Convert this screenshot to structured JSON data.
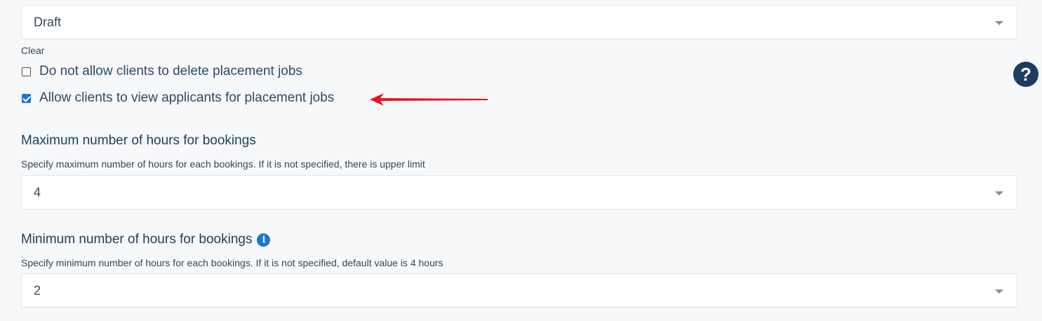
{
  "status_select": {
    "value": "Draft"
  },
  "clear_label": "Clear",
  "checkboxes": [
    {
      "label": "Do not allow clients to delete placement jobs",
      "checked": false
    },
    {
      "label": "Allow clients to view applicants for placement jobs",
      "checked": true
    }
  ],
  "help_icon": {
    "glyph": "?",
    "name": "question-circle-icon"
  },
  "annotation": {
    "color": "#e8141a",
    "name": "red-arrow"
  },
  "max_hours": {
    "title": "Maximum number of hours for bookings",
    "description": "Specify maximum number of hours for each bookings. If it is not specified, there is upper limit",
    "value": "4"
  },
  "min_hours": {
    "title": "Minimum number of hours for bookings",
    "info_glyph": "i",
    "description": "Specify minimum number of hours for each bookings. If it is not specified, default value is 4 hours",
    "value": "2"
  },
  "colors": {
    "accent": "#1a73e8",
    "heading": "#1f3d5c",
    "help_bg": "#1d3d60"
  }
}
